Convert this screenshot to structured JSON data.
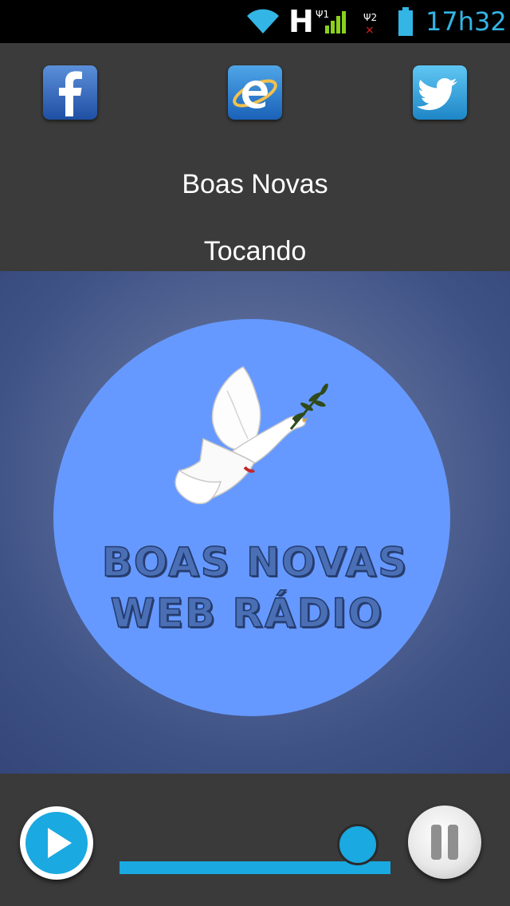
{
  "status_bar": {
    "network_type": "H",
    "time": "17h32",
    "icons": [
      "wifi-icon",
      "signal-sim1-icon",
      "signal-sim2-no-service-icon",
      "battery-icon"
    ]
  },
  "social": {
    "facebook": "facebook-icon",
    "website": "internet-explorer-icon",
    "twitter": "twitter-icon"
  },
  "station": {
    "name": "Boas Novas",
    "status": "Tocando"
  },
  "artwork": {
    "logo_line1": "BOAS NOVAS",
    "logo_line2": "WEB RÁDIO",
    "circle_color": "#6699ff"
  },
  "player": {
    "play_icon": "play-icon",
    "pause_icon": "pause-icon",
    "volume_fraction": 0.88,
    "accent": "#1aa9e0"
  }
}
